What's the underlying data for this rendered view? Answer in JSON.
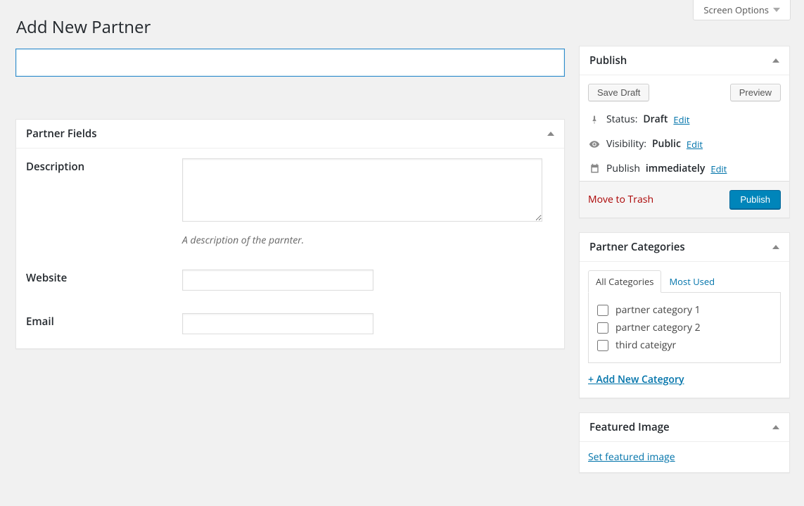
{
  "screen_options_label": "Screen Options",
  "page_title": "Add New Partner",
  "title_input_value": "",
  "partner_fields": {
    "heading": "Partner Fields",
    "description_label": "Description",
    "description_value": "",
    "description_help": "A description of the parnter.",
    "website_label": "Website",
    "website_value": "",
    "email_label": "Email",
    "email_value": ""
  },
  "publish": {
    "heading": "Publish",
    "save_draft": "Save Draft",
    "preview": "Preview",
    "status_label": "Status:",
    "status_value": "Draft",
    "status_edit": "Edit",
    "visibility_label": "Visibility:",
    "visibility_value": "Public",
    "visibility_edit": "Edit",
    "schedule_label": "Publish",
    "schedule_value": "immediately",
    "schedule_edit": "Edit",
    "trash": "Move to Trash",
    "publish_button": "Publish"
  },
  "categories": {
    "heading": "Partner Categories",
    "tab_all": "All Categories",
    "tab_most_used": "Most Used",
    "items": [
      "partner category 1",
      "partner category 2",
      "third cateigyr"
    ],
    "add_new": "+ Add New Category"
  },
  "featured_image": {
    "heading": "Featured Image",
    "set_link": "Set featured image"
  }
}
